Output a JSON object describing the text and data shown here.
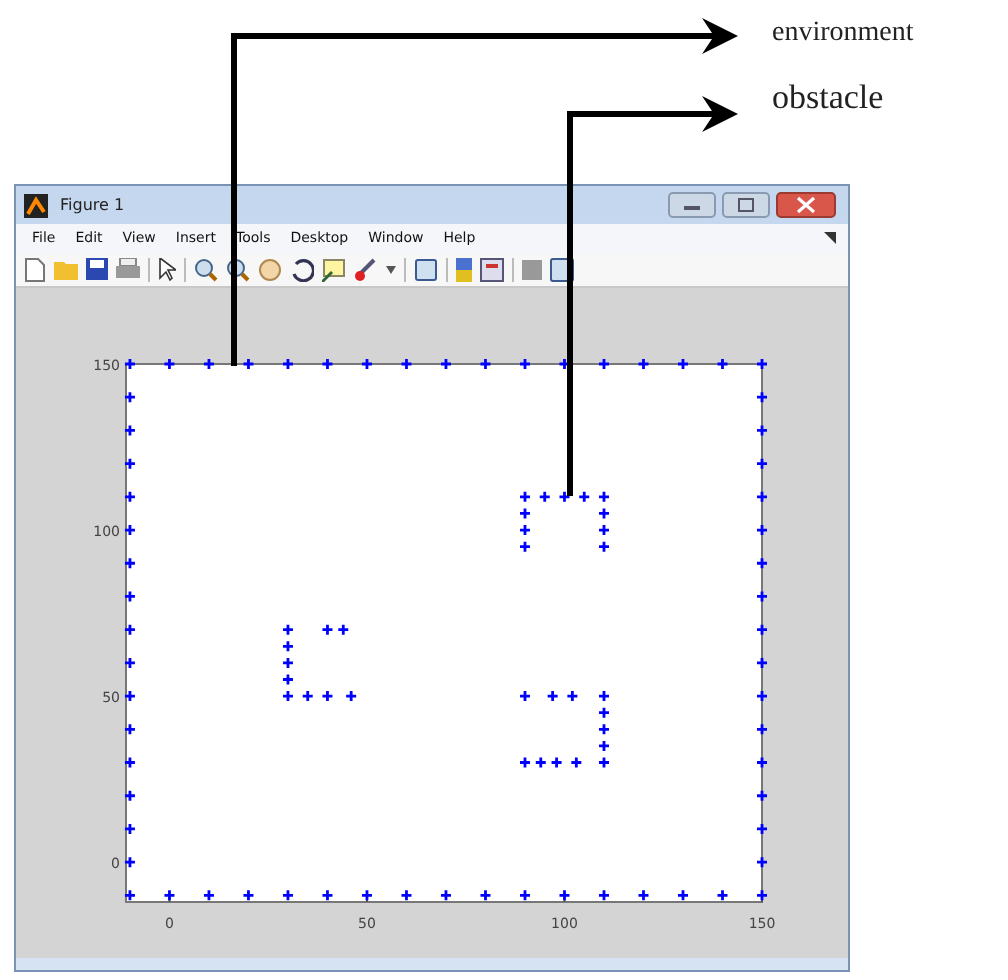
{
  "annotations": [
    {
      "label": "environment"
    },
    {
      "label": "obstacle"
    }
  ],
  "window": {
    "title": "Figure 1",
    "menu": [
      "File",
      "Edit",
      "View",
      "Insert",
      "Tools",
      "Desktop",
      "Window",
      "Help"
    ],
    "chart_data": {
      "type": "scatter",
      "xlim": [
        -11,
        150
      ],
      "ylim": [
        -12,
        150
      ],
      "xticks": [
        0,
        50,
        100,
        150
      ],
      "yticks": [
        0,
        50,
        100,
        150
      ],
      "x": [
        -10,
        0,
        10,
        20,
        30,
        40,
        50,
        60,
        70,
        80,
        90,
        100,
        110,
        120,
        130,
        140,
        150,
        -10,
        0,
        10,
        20,
        30,
        40,
        50,
        60,
        70,
        80,
        90,
        100,
        110,
        120,
        130,
        140,
        150,
        -10,
        -10,
        -10,
        -10,
        -10,
        -10,
        -10,
        -10,
        -10,
        -10,
        -10,
        -10,
        -10,
        -10,
        -10,
        150,
        150,
        150,
        150,
        150,
        150,
        150,
        150,
        150,
        150,
        150,
        150,
        150,
        150,
        150,
        30,
        30,
        30,
        30,
        30,
        40,
        44,
        35,
        40,
        46,
        90,
        95,
        100,
        105,
        110,
        90,
        90,
        90,
        110,
        110,
        110,
        90,
        97,
        102,
        110,
        110,
        110,
        110,
        90,
        94,
        98,
        103,
        110
      ],
      "series": [
        {
          "color": "#0000ff",
          "values": [
            -10,
            -10,
            -10,
            -10,
            -10,
            -10,
            -10,
            -10,
            -10,
            -10,
            -10,
            -10,
            -10,
            -10,
            -10,
            -10,
            -10,
            150,
            150,
            150,
            150,
            150,
            150,
            150,
            150,
            150,
            150,
            150,
            150,
            150,
            150,
            150,
            150,
            150,
            0,
            10,
            20,
            30,
            40,
            50,
            60,
            70,
            80,
            90,
            100,
            110,
            120,
            130,
            140,
            0,
            10,
            20,
            30,
            40,
            50,
            60,
            70,
            80,
            90,
            100,
            110,
            120,
            130,
            140,
            70,
            65,
            60,
            55,
            50,
            70,
            70,
            50,
            50,
            50,
            110,
            110,
            110,
            110,
            110,
            105,
            100,
            95,
            105,
            100,
            95,
            50,
            50,
            50,
            50,
            45,
            40,
            35,
            30,
            30,
            30,
            30,
            30
          ]
        }
      ]
    }
  }
}
